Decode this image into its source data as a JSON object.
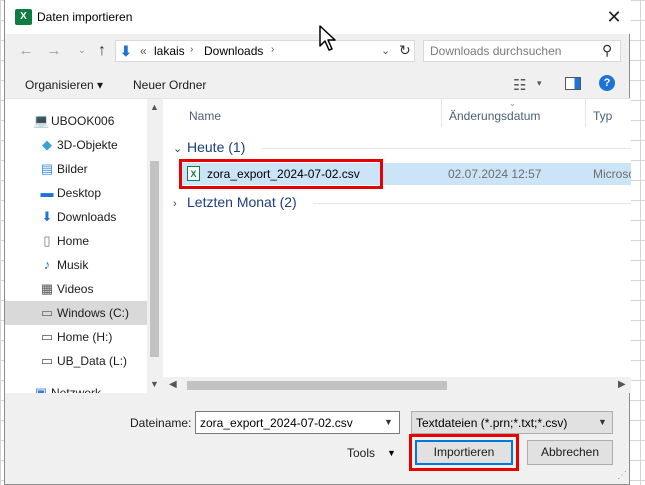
{
  "window": {
    "title": "Daten importieren",
    "app_icon": "excel-icon",
    "close": "✕"
  },
  "address": {
    "back": "←",
    "forward": "→",
    "recent": "⌄",
    "up": "↑",
    "separator": "«",
    "crumbs": [
      "lakais",
      "Downloads"
    ],
    "crumb_arrow": "›",
    "dropdown": "⌄",
    "refresh": "↻"
  },
  "search": {
    "placeholder": "Downloads durchsuchen",
    "icon": "⚲"
  },
  "toolbar": {
    "organize_label": "Organisieren ▾",
    "new_folder_label": "Neuer Ordner",
    "view_icon": "☷",
    "view_drop": "▾",
    "help": "?"
  },
  "nav": {
    "items": [
      {
        "label": "UBOOK006",
        "icon": "computer-icon",
        "glyph": "💻",
        "indent": 1,
        "selected": false
      },
      {
        "label": "3D-Objekte",
        "icon": "cube-icon",
        "glyph": "◆",
        "indent": 2,
        "selected": false
      },
      {
        "label": "Bilder",
        "icon": "pictures-icon",
        "glyph": "▤",
        "indent": 2,
        "selected": false
      },
      {
        "label": "Desktop",
        "icon": "desktop-icon",
        "glyph": "▬",
        "indent": 2,
        "selected": false
      },
      {
        "label": "Downloads",
        "icon": "download-icon",
        "glyph": "⬇",
        "indent": 2,
        "selected": false
      },
      {
        "label": "Home",
        "icon": "document-icon",
        "glyph": "▯",
        "indent": 2,
        "selected": false
      },
      {
        "label": "Musik",
        "icon": "music-icon",
        "glyph": "♪",
        "indent": 2,
        "selected": false
      },
      {
        "label": "Videos",
        "icon": "video-icon",
        "glyph": "▦",
        "indent": 2,
        "selected": false
      },
      {
        "label": "Windows (C:)",
        "icon": "drive-icon",
        "glyph": "▭",
        "indent": 2,
        "selected": true
      },
      {
        "label": "Home (H:)",
        "icon": "network-drive-icon",
        "glyph": "▭",
        "indent": 2,
        "selected": false
      },
      {
        "label": "UB_Data (L:)",
        "icon": "network-drive-icon",
        "glyph": "▭",
        "indent": 2,
        "selected": false
      },
      {
        "label": "Netzwerk",
        "icon": "network-icon",
        "glyph": "▣",
        "indent": 1,
        "selected": false
      }
    ]
  },
  "columns": {
    "name": "Name",
    "date": "Änderungsdatum",
    "type": "Typ"
  },
  "groups": {
    "today": "Heute (1)",
    "last_month": "Letzten Monat (2)",
    "chev_open": "⌄",
    "chev_closed": "›"
  },
  "file": {
    "name": "zora_export_2024-07-02.csv",
    "date": "02.07.2024 12:57",
    "type": "Microso",
    "icon": "X"
  },
  "footer": {
    "filename_label": "Dateiname:",
    "filename_value": "zora_export_2024-07-02.csv",
    "filter_value": "Textdateien (*.prn;*.txt;*.csv)",
    "tools_label": "Tools",
    "import_label": "Importieren",
    "cancel_label": "Abbrechen"
  },
  "colors": {
    "highlight": "#e60000",
    "selection": "#cce4f7",
    "accent": "#0078d7",
    "excel_green": "#107c41"
  }
}
